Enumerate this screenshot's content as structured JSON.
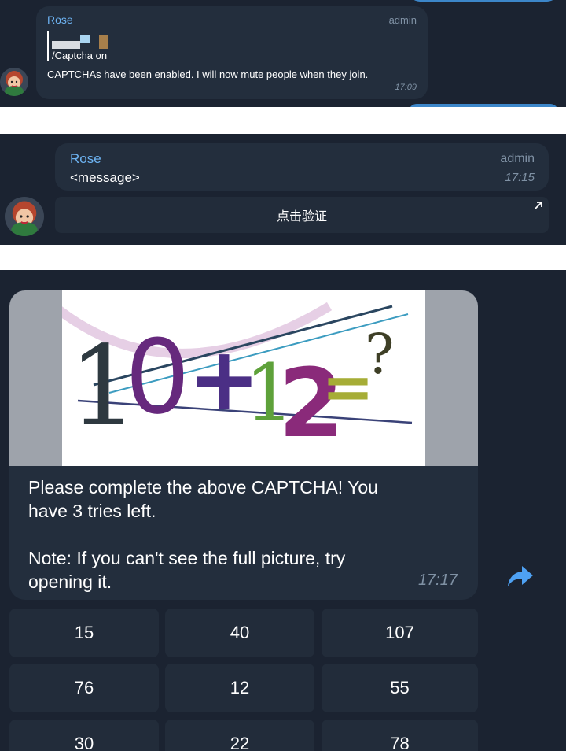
{
  "panel1": {
    "sender": "Rose",
    "role": "admin",
    "command": "/Captcha on",
    "text": "CAPTCHAs have been enabled. I will now mute people when they join.",
    "time": "17:09"
  },
  "panel2": {
    "sender": "Rose",
    "placeholder_message": "<message>",
    "role": "admin",
    "time": "17:15",
    "verify_button": "点击验证"
  },
  "panel3": {
    "captcha_image": {
      "tokens": [
        "1",
        "0",
        "+",
        "1",
        "2",
        "=",
        "?"
      ]
    },
    "message_line1": "Please complete the above CAPTCHA! You",
    "message_line2": "have 3 tries left.",
    "note_line1": "Note: If you can't see the full picture, try",
    "note_line2": "opening it.",
    "time": "17:17",
    "answers": [
      "15",
      "40",
      "107",
      "76",
      "12",
      "55",
      "30",
      "22",
      "78"
    ]
  },
  "colors": {
    "chat_bg": "#1b2331",
    "bubble_bg": "#232e3d",
    "sender": "#6db3f2",
    "forward": "#4ea1f3"
  }
}
